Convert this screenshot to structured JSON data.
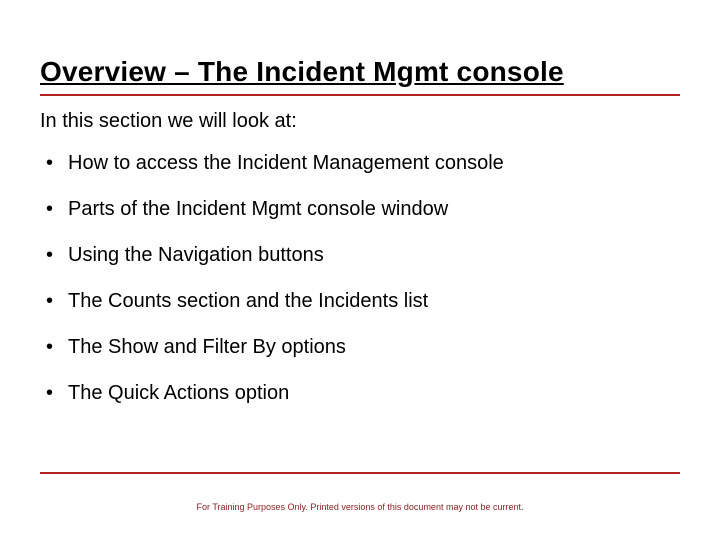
{
  "title": "Overview – The Incident Mgmt console",
  "intro": "In this section we will look at:",
  "bullets": [
    "How to access the Incident Management console",
    "Parts of the Incident Mgmt console window",
    "Using the Navigation buttons",
    "The Counts section and the Incidents list",
    "The Show and Filter By options",
    "The Quick Actions option"
  ],
  "footer": "For Training Purposes Only. Printed versions of this document may not be current."
}
